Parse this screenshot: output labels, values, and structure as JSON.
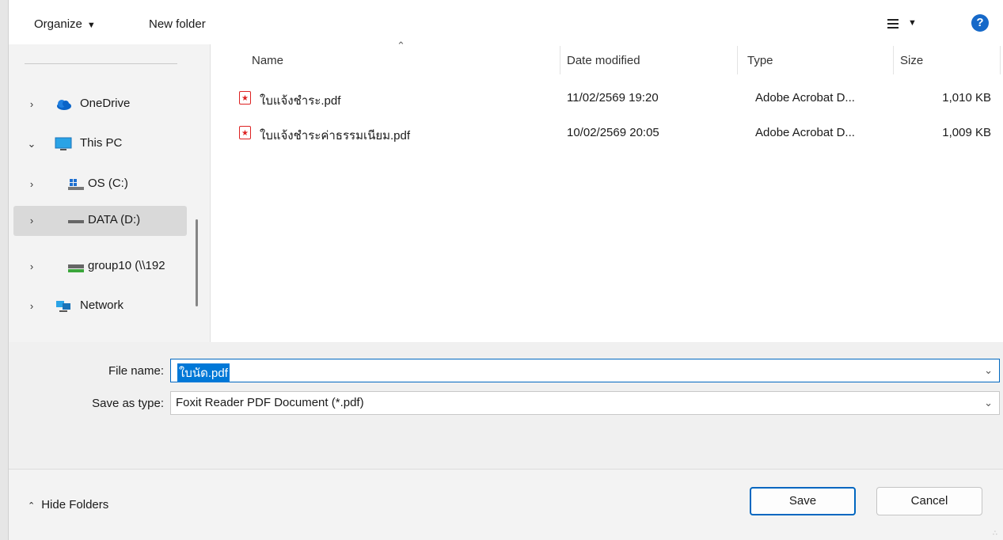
{
  "toolbar": {
    "organize_label": "Organize",
    "new_folder_label": "New folder",
    "help_glyph": "?"
  },
  "nav": {
    "items": [
      {
        "label": "OneDrive",
        "icon": "cloud-icon",
        "expanded": false
      },
      {
        "label": "This PC",
        "icon": "monitor-icon",
        "expanded": true
      },
      {
        "label": "OS (C:)",
        "icon": "windows-drive-icon",
        "expanded": false
      },
      {
        "label": "DATA (D:)",
        "icon": "drive-icon",
        "expanded": false,
        "selected": true
      },
      {
        "label": "group10 (\\\\192",
        "icon": "network-drive-icon",
        "expanded": false
      },
      {
        "label": "Network",
        "icon": "network-icon",
        "expanded": false
      }
    ]
  },
  "filelist": {
    "columns": {
      "name": "Name",
      "date": "Date modified",
      "type": "Type",
      "size": "Size"
    },
    "rows": [
      {
        "name": "ใบแจ้งชำระ.pdf",
        "date": "11/02/2569 19:20",
        "type": "Adobe Acrobat D...",
        "size": "1,010 KB"
      },
      {
        "name": "ใบแจ้งชำระค่าธรรมเนียม.pdf",
        "date": "10/02/2569 20:05",
        "type": "Adobe Acrobat D...",
        "size": "1,009 KB"
      }
    ]
  },
  "form": {
    "file_name_label": "File name:",
    "file_name_value": "ใบนัด.pdf",
    "save_type_label": "Save as type:",
    "save_type_value": "Foxit Reader PDF Document (*.pdf)"
  },
  "footer": {
    "hide_folders_label": "Hide Folders",
    "save_label": "Save",
    "cancel_label": "Cancel"
  },
  "colors": {
    "accent": "#0067c0",
    "selection": "#0078d7",
    "pdf_red": "#d22222"
  }
}
